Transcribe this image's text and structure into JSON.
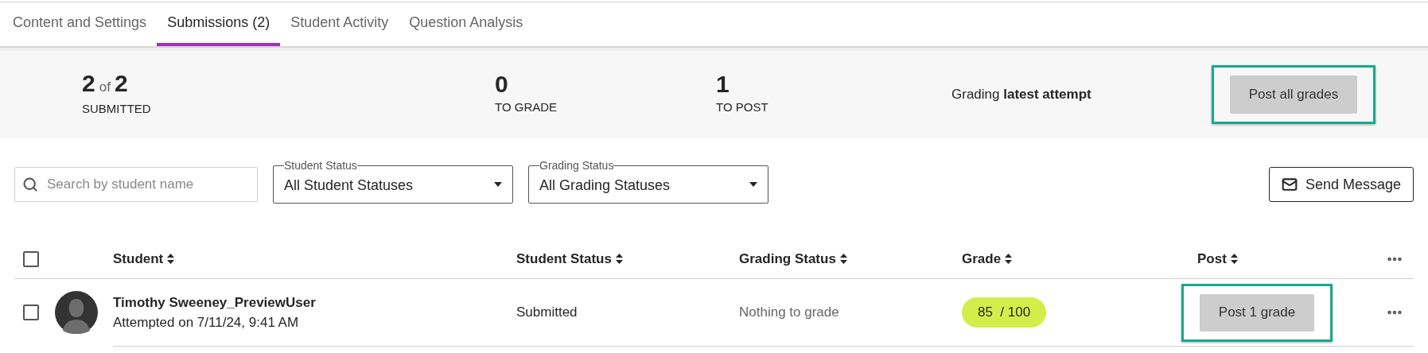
{
  "tabs": [
    {
      "label": "Content and Settings",
      "selected": false
    },
    {
      "label": "Submissions (2)",
      "selected": true
    },
    {
      "label": "Student Activity",
      "selected": false
    },
    {
      "label": "Question Analysis",
      "selected": false
    }
  ],
  "summary": {
    "stats": [
      {
        "value": "2",
        "of": "of",
        "total": "2",
        "label": "SUBMITTED"
      },
      {
        "value": "0",
        "label": "TO GRADE"
      },
      {
        "value": "1",
        "label": "TO POST"
      }
    ],
    "grading_mode": "Grading **latest attempt**",
    "post_all_button": {
      "label": "Post all grades",
      "highlighted": true
    }
  },
  "filters": {
    "search": {
      "placeholder": "Search by student name"
    },
    "selects": [
      {
        "label": "Student Status",
        "value": "All Student Statuses"
      },
      {
        "label": "Grading Status",
        "value": "All Grading Statuses"
      }
    ],
    "send_message_button": "Send Message"
  },
  "table": {
    "select_all_checked": false,
    "columns": [
      "Student",
      "Student Status",
      "Grading Status",
      "Grade",
      "Post"
    ],
    "rows": [
      {
        "checked": false,
        "name": "Timothy Sweeney_PreviewUser",
        "attempted": "Attempted on 7/11/24, 9:41 AM",
        "student_status": "Submitted",
        "grading_status": "Nothing to grade",
        "grade": "85  / 100",
        "post_button": {
          "label": "Post 1 grade",
          "highlighted": true
        }
      }
    ]
  }
}
